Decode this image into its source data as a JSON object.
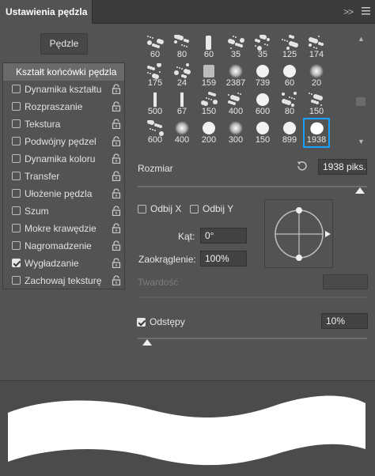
{
  "panel": {
    "title": "Ustawienia pędzla",
    "tab_controls": ">>",
    "menu_icon": "panel-menu-icon"
  },
  "brushes_button": "Pędzle",
  "options": {
    "header": "Kształt końcówki pędzla",
    "items": [
      {
        "label": "Dynamika kształtu",
        "checked": false
      },
      {
        "label": "Rozpraszanie",
        "checked": false
      },
      {
        "label": "Tekstura",
        "checked": false
      },
      {
        "label": "Podwójny pędzel",
        "checked": false
      },
      {
        "label": "Dynamika koloru",
        "checked": false
      },
      {
        "label": "Transfer",
        "checked": false
      },
      {
        "label": "Ułożenie pędzla",
        "checked": false
      },
      {
        "label": "Szum",
        "checked": false
      },
      {
        "label": "Mokre krawędzie",
        "checked": false
      },
      {
        "label": "Nagromadzenie",
        "checked": false
      },
      {
        "label": "Wygładzanie",
        "checked": true
      },
      {
        "label": "Zachowaj teksturę",
        "checked": false
      }
    ]
  },
  "presets": {
    "rows": [
      [
        "60",
        "80",
        "60",
        "35",
        "35",
        "125",
        "174"
      ],
      [
        "175",
        "24",
        "159",
        "2387",
        "739",
        "60",
        "20"
      ],
      [
        "500",
        "67",
        "150",
        "400",
        "600",
        "80",
        "150"
      ],
      [
        "600",
        "400",
        "200",
        "300",
        "150",
        "899",
        "1938"
      ]
    ],
    "selected": "1938"
  },
  "size": {
    "label": "Rozmiar",
    "value": "1938 piks.",
    "level": 0.97
  },
  "flip": {
    "x_label": "Odbij X",
    "y_label": "Odbij Y",
    "x_checked": false,
    "y_checked": false
  },
  "angle": {
    "label": "Kąt:",
    "value": "0°"
  },
  "roundness": {
    "label": "Zaokrąglenie:",
    "value": "100%"
  },
  "hardness": {
    "label": "Twardość",
    "value": ""
  },
  "spacing": {
    "label": "Odstępy",
    "checked": true,
    "value": "10%",
    "level": 0.04
  },
  "colors": {
    "accent": "#1aa0ff",
    "panel": "#535353",
    "stroke": "#ffffff"
  }
}
